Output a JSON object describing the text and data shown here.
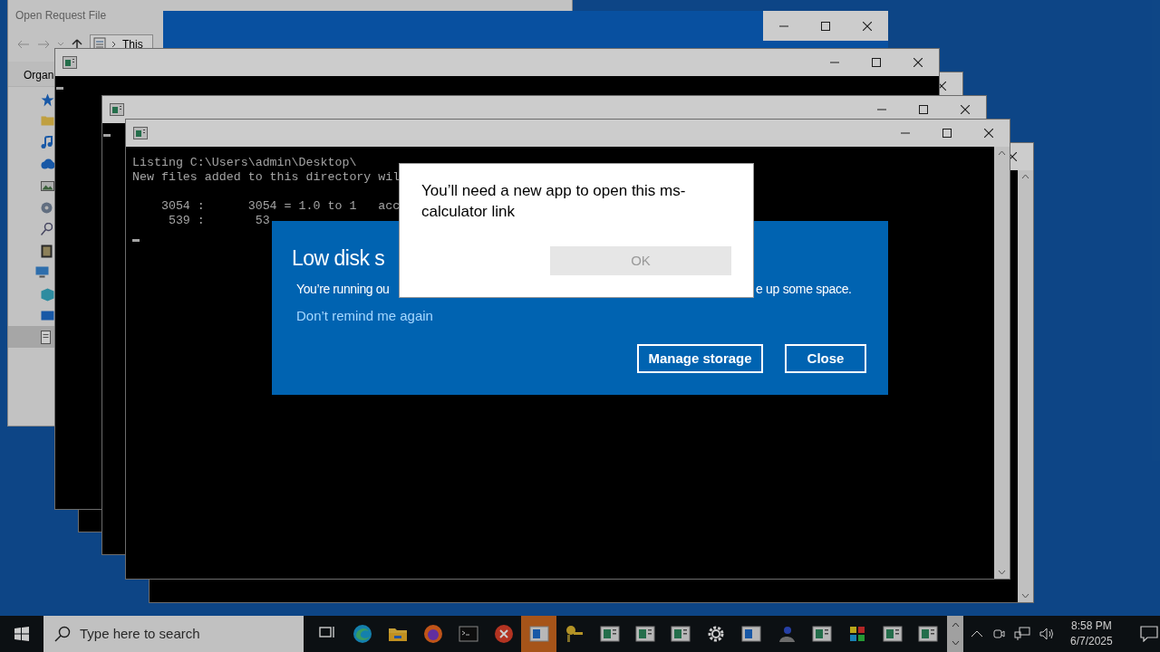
{
  "explorer_window": {
    "title": "Open Request File",
    "address": "This",
    "toolbar": "Organ",
    "nav_items": [
      {
        "selected": false
      },
      {
        "selected": false
      },
      {
        "selected": false
      },
      {
        "selected": false
      },
      {
        "selected": false
      },
      {
        "selected": false
      },
      {
        "selected": false
      },
      {
        "selected": false
      },
      {
        "selected": false
      },
      {
        "selected": false
      },
      {
        "selected": false
      },
      {
        "selected": true
      }
    ]
  },
  "windows": [
    {
      "kind": "blue"
    },
    {
      "kind": "console"
    },
    {
      "kind": "console"
    },
    {
      "kind": "console"
    },
    {
      "kind": "console"
    },
    {
      "kind": "console",
      "paragraphs": [
        [
          "Listing C:\\Users\\admin\\Desktop\\",
          "New files added to this directory wil"
        ],
        [
          "    3054 :      3054 = 1.0 to 1   acc",
          "     539 :       53"
        ]
      ]
    }
  ],
  "low_disk_dialog": {
    "title": "Low disk s",
    "message_parts": [
      "You’re running ou",
      "e up some space."
    ],
    "link": "Don’t remind me again",
    "buttons": [
      "Manage storage",
      "Close"
    ]
  },
  "app_dialog": {
    "message": "You’ll need a new app to open this ms-calculator link",
    "button": {
      "label": "OK",
      "disabled": true
    }
  },
  "taskbar": {
    "search_placeholder": "Type here to search",
    "apps": [
      {
        "kind": "taskview",
        "active": false
      },
      {
        "kind": "edge",
        "active": false
      },
      {
        "kind": "explorer",
        "active": false
      },
      {
        "kind": "firefox",
        "active": false
      },
      {
        "kind": "terminal",
        "active": false
      },
      {
        "kind": "error",
        "active": false
      },
      {
        "kind": "window",
        "active": true
      },
      {
        "kind": "keys",
        "active": false
      },
      {
        "kind": "console",
        "active": false
      },
      {
        "kind": "console",
        "active": false
      },
      {
        "kind": "console",
        "active": false
      },
      {
        "kind": "gear",
        "active": false
      },
      {
        "kind": "window",
        "active": false
      },
      {
        "kind": "user",
        "active": false
      },
      {
        "kind": "console",
        "active": false
      },
      {
        "kind": "puzzle",
        "active": false
      },
      {
        "kind": "console",
        "active": false
      },
      {
        "kind": "console",
        "active": false
      }
    ],
    "clock": {
      "time": "8:58 PM",
      "date": "6/7/2025"
    }
  }
}
